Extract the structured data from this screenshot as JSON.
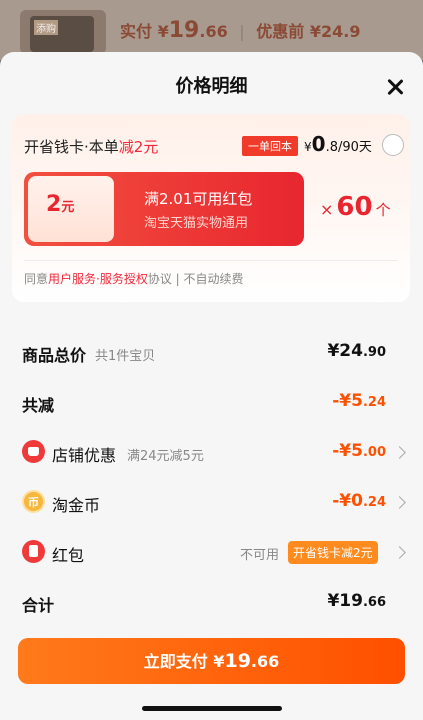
{
  "background": {
    "thumb_label": "添购",
    "price_label": "实付",
    "price_yen": "¥",
    "price_int": "19",
    "price_dec": ".66",
    "sep": "|",
    "before_label": "优惠前",
    "before_price": "¥24.9"
  },
  "sheet": {
    "title": "价格明细"
  },
  "promo": {
    "title_pre": "开省钱卡·本单",
    "title_hl": "减2元",
    "tag": "一单回本",
    "price_yen": "¥",
    "price_int": "0",
    "price_rest": ".8/90天",
    "coupon_amount": "2",
    "coupon_unit": "元",
    "coupon_condition": "满2.01可用红包",
    "coupon_desc": "淘宝天猫实物通用",
    "qty_x": "×",
    "qty": "60",
    "qty_unit": "个",
    "agree_pre": "同意",
    "agree_link": "用户服务·服务授权",
    "agree_post": "协议 | 不自动续费"
  },
  "rows": {
    "total": {
      "label": "商品总价",
      "sub": "共1件宝贝",
      "val_int": "¥24",
      "val_dec": ".90"
    },
    "reduce": {
      "label": "共减",
      "val_int": "-¥5",
      "val_dec": ".24"
    },
    "shop": {
      "label": "店铺优惠",
      "sub": "满24元减5元",
      "val_int": "-¥5",
      "val_dec": ".00"
    },
    "coin": {
      "icon_char": "币",
      "label": "淘金币",
      "val_int": "-¥0",
      "val_dec": ".24"
    },
    "hongbao": {
      "label": "红包",
      "unavailable": "不可用",
      "tag": "开省钱卡减2元"
    },
    "sum": {
      "label": "合计",
      "val_int": "¥19",
      "val_dec": ".66"
    }
  },
  "pay": {
    "label": "立即支付",
    "yen": "¥",
    "int": "19",
    "dec": ".66"
  },
  "colors": {
    "accent_red": "#f2293b",
    "accent_orange": "#ff5000"
  }
}
